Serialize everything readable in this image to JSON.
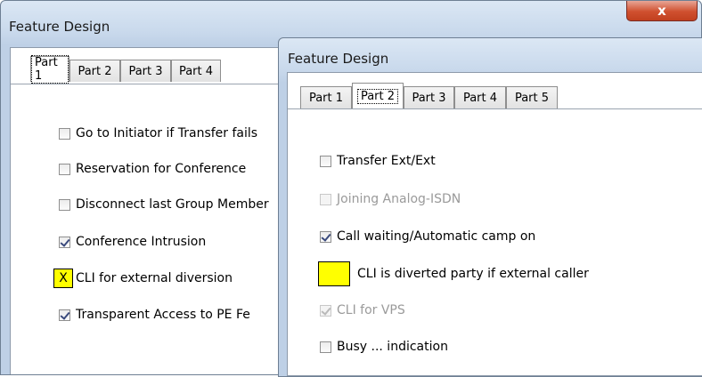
{
  "back_window": {
    "title": "Feature Design",
    "close_label": "x",
    "tabs": [
      {
        "label": "Part 1",
        "active": true
      },
      {
        "label": "Part 2"
      },
      {
        "label": "Part 3"
      },
      {
        "label": "Part 4"
      }
    ],
    "options": [
      {
        "label": "Go to Initiator if Transfer fails",
        "checked": false
      },
      {
        "label": "Reservation for Conference",
        "checked": false
      },
      {
        "label": "Disconnect last Group Member",
        "checked": false
      },
      {
        "label": "Conference Intrusion",
        "checked": true
      },
      {
        "label": "CLI for external diversion",
        "marker": "X"
      },
      {
        "label": "Transparent Access to PE Fe",
        "checked": true
      }
    ]
  },
  "front_window": {
    "title": "Feature Design",
    "tabs": [
      {
        "label": "Part 1"
      },
      {
        "label": "Part 2",
        "active": true
      },
      {
        "label": "Part 3"
      },
      {
        "label": "Part 4"
      },
      {
        "label": "Part 5"
      }
    ],
    "options": [
      {
        "label": "Transfer Ext/Ext",
        "checked": false
      },
      {
        "label": "Joining Analog-ISDN",
        "checked": false,
        "disabled": true
      },
      {
        "label": "Call waiting/Automatic camp on",
        "checked": true
      },
      {
        "label": "CLI is diverted party if external caller",
        "marker": ""
      },
      {
        "label": "CLI for VPS",
        "checked": true,
        "disabled": true
      },
      {
        "label": "Busy ... indication",
        "checked": false
      }
    ]
  },
  "colors": {
    "highlight": "#ffff00",
    "close_button": "#c9472a",
    "title_bar": "#c9d9ec"
  }
}
